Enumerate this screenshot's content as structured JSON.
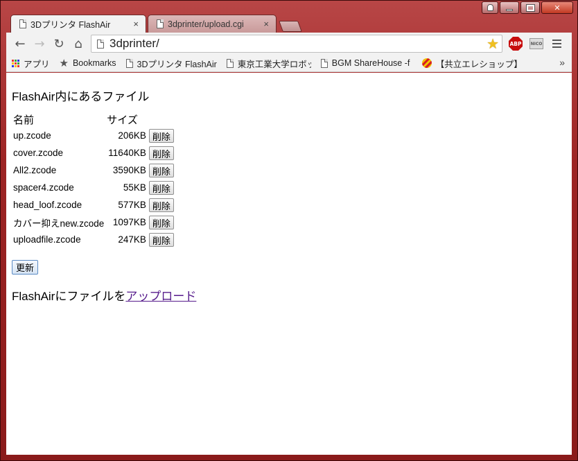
{
  "window": {
    "controls": [
      "user",
      "minimize",
      "maximize",
      "close"
    ]
  },
  "tabs": [
    {
      "label": "3Dプリンタ FlashAir",
      "active": true,
      "close": "×"
    },
    {
      "label": "3dprinter/upload.cgi",
      "active": false,
      "close": "×"
    }
  ],
  "toolbar": {
    "back": "←",
    "forward": "→",
    "reload": "↻",
    "home": "⌂",
    "url": "3dprinter/",
    "star": "★",
    "abp_label": "ABP",
    "nico_label": "NICO"
  },
  "bookmarks": [
    {
      "label": "アプリ",
      "icon": "apps-icon"
    },
    {
      "label": "Bookmarks",
      "icon": "star-icon"
    },
    {
      "label": "3Dプリンタ FlashAir",
      "icon": "page-icon"
    },
    {
      "label": "東京工業大学ロボット",
      "icon": "page-icon"
    },
    {
      "label": "BGM ShareHouse -f",
      "icon": "page-icon"
    },
    {
      "label": "【共立エレショップ】",
      "icon": "kyoritsu-icon"
    }
  ],
  "bookmarks_overflow": "»",
  "page": {
    "heading": "FlashAir内にあるファイル",
    "col_name": "名前",
    "col_size": "サイズ",
    "delete_label": "削除",
    "files": [
      {
        "name": "up.zcode",
        "size": "206KB"
      },
      {
        "name": "cover.zcode",
        "size": "11640KB"
      },
      {
        "name": "All2.zcode",
        "size": "3590KB"
      },
      {
        "name": "spacer4.zcode",
        "size": "55KB"
      },
      {
        "name": "head_loof.zcode",
        "size": "577KB"
      },
      {
        "name": "カバー抑えnew.zcode",
        "size": "1097KB"
      },
      {
        "name": "uploadfile.zcode",
        "size": "247KB"
      }
    ],
    "update_label": "更新",
    "upload_prefix": "FlashAirにファイルを",
    "upload_link": "アップロード"
  },
  "colors": {
    "link_visited": "#551a8b",
    "frame_red": "#9d2424",
    "abp_red": "#c70d0d",
    "star_yellow": "#f0c020"
  }
}
